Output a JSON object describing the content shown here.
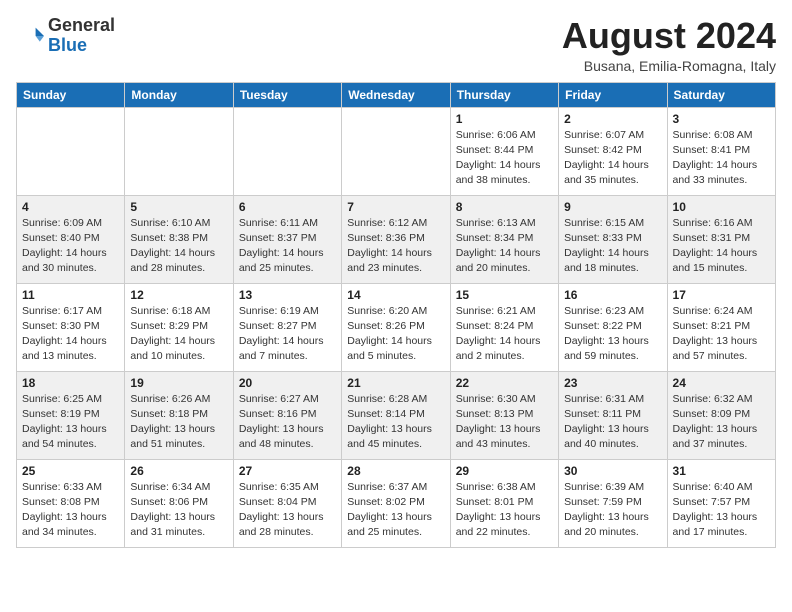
{
  "header": {
    "logo": {
      "general": "General",
      "blue": "Blue"
    },
    "title": "August 2024",
    "location": "Busana, Emilia-Romagna, Italy"
  },
  "weekdays": [
    "Sunday",
    "Monday",
    "Tuesday",
    "Wednesday",
    "Thursday",
    "Friday",
    "Saturday"
  ],
  "weeks": [
    [
      {
        "day": "",
        "info": ""
      },
      {
        "day": "",
        "info": ""
      },
      {
        "day": "",
        "info": ""
      },
      {
        "day": "",
        "info": ""
      },
      {
        "day": "1",
        "info": "Sunrise: 6:06 AM\nSunset: 8:44 PM\nDaylight: 14 hours\nand 38 minutes."
      },
      {
        "day": "2",
        "info": "Sunrise: 6:07 AM\nSunset: 8:42 PM\nDaylight: 14 hours\nand 35 minutes."
      },
      {
        "day": "3",
        "info": "Sunrise: 6:08 AM\nSunset: 8:41 PM\nDaylight: 14 hours\nand 33 minutes."
      }
    ],
    [
      {
        "day": "4",
        "info": "Sunrise: 6:09 AM\nSunset: 8:40 PM\nDaylight: 14 hours\nand 30 minutes."
      },
      {
        "day": "5",
        "info": "Sunrise: 6:10 AM\nSunset: 8:38 PM\nDaylight: 14 hours\nand 28 minutes."
      },
      {
        "day": "6",
        "info": "Sunrise: 6:11 AM\nSunset: 8:37 PM\nDaylight: 14 hours\nand 25 minutes."
      },
      {
        "day": "7",
        "info": "Sunrise: 6:12 AM\nSunset: 8:36 PM\nDaylight: 14 hours\nand 23 minutes."
      },
      {
        "day": "8",
        "info": "Sunrise: 6:13 AM\nSunset: 8:34 PM\nDaylight: 14 hours\nand 20 minutes."
      },
      {
        "day": "9",
        "info": "Sunrise: 6:15 AM\nSunset: 8:33 PM\nDaylight: 14 hours\nand 18 minutes."
      },
      {
        "day": "10",
        "info": "Sunrise: 6:16 AM\nSunset: 8:31 PM\nDaylight: 14 hours\nand 15 minutes."
      }
    ],
    [
      {
        "day": "11",
        "info": "Sunrise: 6:17 AM\nSunset: 8:30 PM\nDaylight: 14 hours\nand 13 minutes."
      },
      {
        "day": "12",
        "info": "Sunrise: 6:18 AM\nSunset: 8:29 PM\nDaylight: 14 hours\nand 10 minutes."
      },
      {
        "day": "13",
        "info": "Sunrise: 6:19 AM\nSunset: 8:27 PM\nDaylight: 14 hours\nand 7 minutes."
      },
      {
        "day": "14",
        "info": "Sunrise: 6:20 AM\nSunset: 8:26 PM\nDaylight: 14 hours\nand 5 minutes."
      },
      {
        "day": "15",
        "info": "Sunrise: 6:21 AM\nSunset: 8:24 PM\nDaylight: 14 hours\nand 2 minutes."
      },
      {
        "day": "16",
        "info": "Sunrise: 6:23 AM\nSunset: 8:22 PM\nDaylight: 13 hours\nand 59 minutes."
      },
      {
        "day": "17",
        "info": "Sunrise: 6:24 AM\nSunset: 8:21 PM\nDaylight: 13 hours\nand 57 minutes."
      }
    ],
    [
      {
        "day": "18",
        "info": "Sunrise: 6:25 AM\nSunset: 8:19 PM\nDaylight: 13 hours\nand 54 minutes."
      },
      {
        "day": "19",
        "info": "Sunrise: 6:26 AM\nSunset: 8:18 PM\nDaylight: 13 hours\nand 51 minutes."
      },
      {
        "day": "20",
        "info": "Sunrise: 6:27 AM\nSunset: 8:16 PM\nDaylight: 13 hours\nand 48 minutes."
      },
      {
        "day": "21",
        "info": "Sunrise: 6:28 AM\nSunset: 8:14 PM\nDaylight: 13 hours\nand 45 minutes."
      },
      {
        "day": "22",
        "info": "Sunrise: 6:30 AM\nSunset: 8:13 PM\nDaylight: 13 hours\nand 43 minutes."
      },
      {
        "day": "23",
        "info": "Sunrise: 6:31 AM\nSunset: 8:11 PM\nDaylight: 13 hours\nand 40 minutes."
      },
      {
        "day": "24",
        "info": "Sunrise: 6:32 AM\nSunset: 8:09 PM\nDaylight: 13 hours\nand 37 minutes."
      }
    ],
    [
      {
        "day": "25",
        "info": "Sunrise: 6:33 AM\nSunset: 8:08 PM\nDaylight: 13 hours\nand 34 minutes."
      },
      {
        "day": "26",
        "info": "Sunrise: 6:34 AM\nSunset: 8:06 PM\nDaylight: 13 hours\nand 31 minutes."
      },
      {
        "day": "27",
        "info": "Sunrise: 6:35 AM\nSunset: 8:04 PM\nDaylight: 13 hours\nand 28 minutes."
      },
      {
        "day": "28",
        "info": "Sunrise: 6:37 AM\nSunset: 8:02 PM\nDaylight: 13 hours\nand 25 minutes."
      },
      {
        "day": "29",
        "info": "Sunrise: 6:38 AM\nSunset: 8:01 PM\nDaylight: 13 hours\nand 22 minutes."
      },
      {
        "day": "30",
        "info": "Sunrise: 6:39 AM\nSunset: 7:59 PM\nDaylight: 13 hours\nand 20 minutes."
      },
      {
        "day": "31",
        "info": "Sunrise: 6:40 AM\nSunset: 7:57 PM\nDaylight: 13 hours\nand 17 minutes."
      }
    ]
  ]
}
